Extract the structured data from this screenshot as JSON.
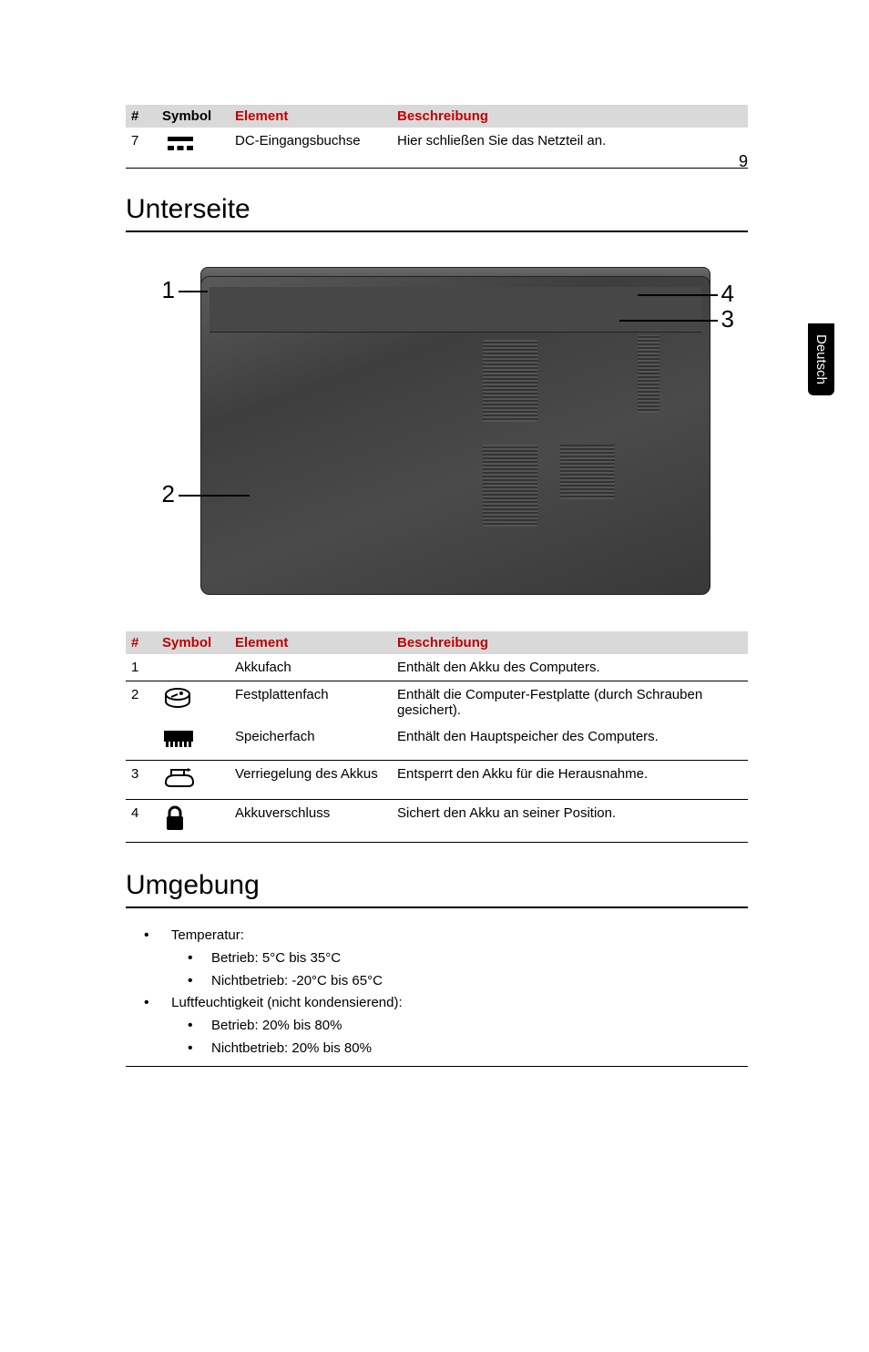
{
  "page_number": "9",
  "side_tab": "Deutsch",
  "table1": {
    "headers": {
      "hash": "#",
      "symbol": "Symbol",
      "element": "Element",
      "desc": "Beschreibung"
    },
    "rows": [
      {
        "num": "7",
        "element": "DC-Eingangsbuchse",
        "desc": "Hier schließen Sie das Netzteil an."
      }
    ]
  },
  "heading_unterseite": "Unterseite",
  "diagram_labels": {
    "one": "1",
    "two": "2",
    "three": "3",
    "four": "4"
  },
  "table2": {
    "headers": {
      "hash": "#",
      "symbol": "Symbol",
      "element": "Element",
      "desc": "Beschreibung"
    },
    "rows": [
      {
        "num": "1",
        "element": "Akkufach",
        "desc": "Enthält den Akku des Computers."
      },
      {
        "num": "2",
        "element": "Festplattenfach",
        "desc": "Enthält die Computer-Festplatte (durch Schrauben gesichert)."
      },
      {
        "num": "",
        "element": "Speicherfach",
        "desc": "Enthält den Hauptspeicher des Computers."
      },
      {
        "num": "3",
        "element": "Verriegelung des Akkus",
        "desc": "Entsperrt den Akku für die Herausnahme."
      },
      {
        "num": "4",
        "element": "Akkuverschluss",
        "desc": "Sichert den Akku an seiner Position."
      }
    ]
  },
  "heading_umgebung": "Umgebung",
  "env": {
    "temp_label": "Temperatur:",
    "temp_op": "Betrieb: 5°C bis 35°C",
    "temp_nonop": "Nichtbetrieb: -20°C bis 65°C",
    "humidity_label": "Luftfeuchtigkeit (nicht kondensierend):",
    "humidity_op": "Betrieb: 20% bis 80%",
    "humidity_nonop": "Nichtbetrieb: 20% bis 80%"
  }
}
